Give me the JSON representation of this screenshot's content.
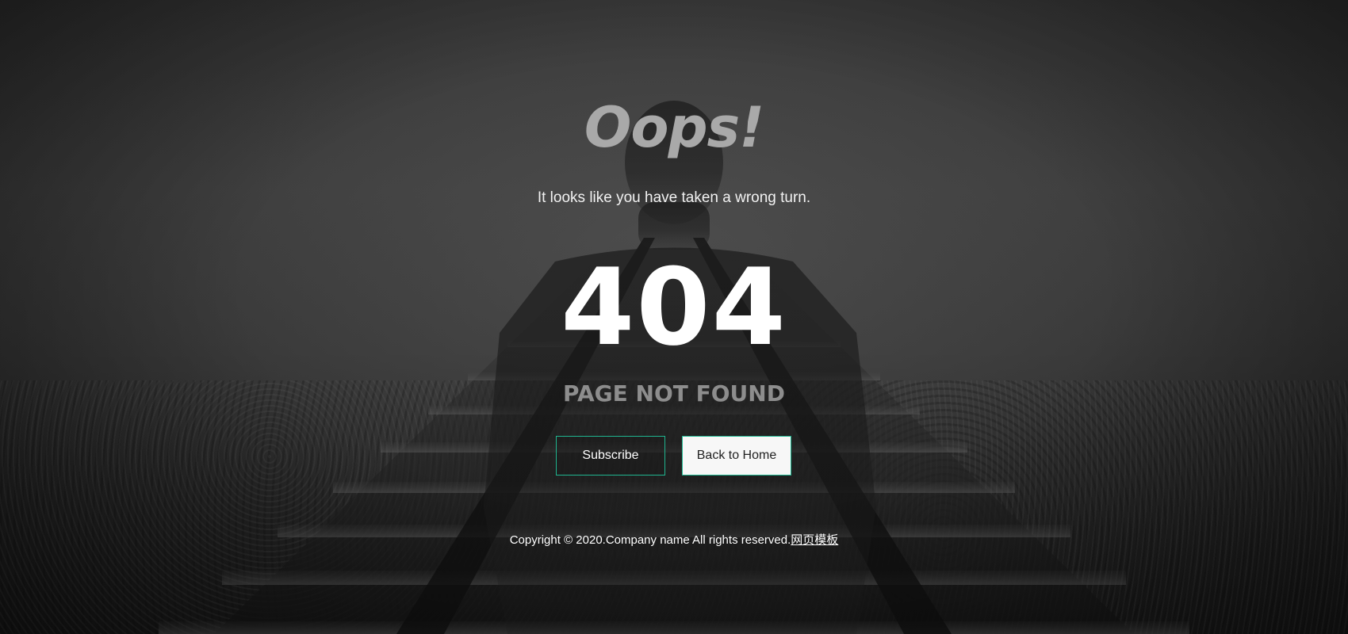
{
  "page": {
    "heading": "Oops!",
    "subtitle": "It looks like you have taken a wrong turn.",
    "error_code": "404",
    "error_message": "PAGE NOT FOUND"
  },
  "buttons": {
    "subscribe_label": "Subscribe",
    "home_label": "Back to Home"
  },
  "footer": {
    "copyright_text": "Copyright © 2020.Company name All rights reserved.",
    "link_text": "网页模板"
  },
  "colors": {
    "accent": "#1fb58f",
    "heading": "#a9a9a9",
    "muted_text": "#8d8d8d",
    "code_text": "#ffffff",
    "home_button_bg": "#f7f7f7"
  },
  "icons": {
    "background": "railway-silhouette-photo"
  }
}
